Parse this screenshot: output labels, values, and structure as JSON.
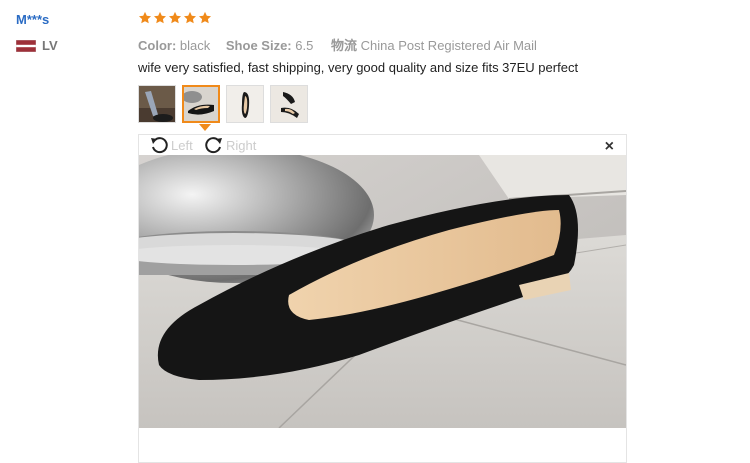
{
  "reviewer": {
    "name": "M***s",
    "country_code": "LV"
  },
  "rating": {
    "stars": 5,
    "max": 5
  },
  "order_info": {
    "color_label": "Color:",
    "color_value": "black",
    "size_label": "Shoe Size:",
    "size_value": "6.5",
    "logistics_label": "物流",
    "logistics_value": "China Post Registered Air Mail"
  },
  "review_text": "wife very satisfied, fast shipping, very good quality and size fits 37EU perfect",
  "thumbnails": [
    {
      "name": "thumb-1",
      "active": false
    },
    {
      "name": "thumb-2",
      "active": true
    },
    {
      "name": "thumb-3",
      "active": false
    },
    {
      "name": "thumb-4",
      "active": false
    }
  ],
  "viewer": {
    "rotate_left_label": "Left",
    "rotate_right_label": "Right",
    "close_symbol": "×"
  },
  "colors": {
    "link_blue": "#2b6cc4",
    "star_orange": "#f08a1a",
    "muted": "#999999"
  }
}
